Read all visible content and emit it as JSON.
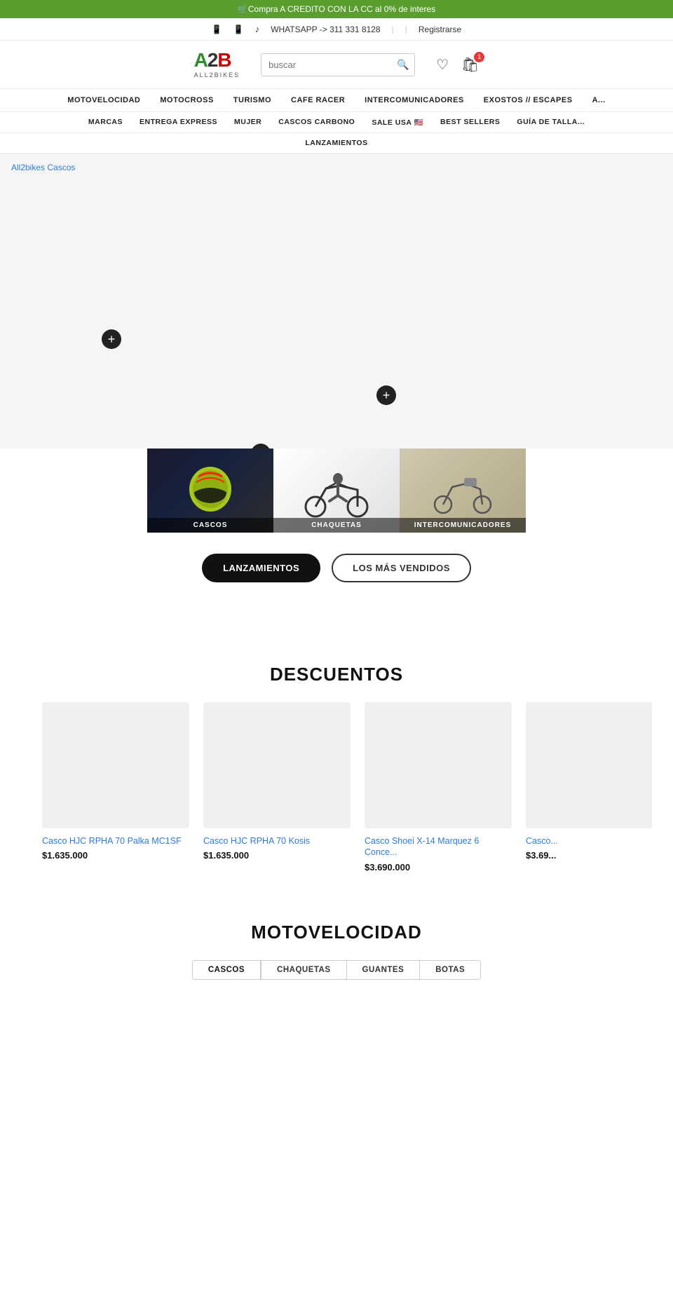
{
  "topBanner": {
    "text": "🛒Compra A CREDITO CON LA CC al 0% de interes"
  },
  "topBar": {
    "phoneIcon1": "📱",
    "phoneIcon2": "📱",
    "tiktokIcon": "♪",
    "whatsapp": "WHATSAPP -> 311 331 8128",
    "sep1": "|",
    "sep2": "|",
    "register": "Registrarse"
  },
  "header": {
    "logoText": "A2B",
    "logoSub": "ALL2BIKES",
    "searchPlaceholder": "buscar",
    "cartCount": "1"
  },
  "navPrimary": [
    "MOTOVELOCIDAD",
    "MOTOCROSS",
    "TURISMO",
    "CAFE RACER",
    "INTERCOMUNICADORES",
    "EXOSTOS // ESCAPES",
    "A..."
  ],
  "navSecondary": [
    "MARCAS",
    "ENTREGA EXPRESS",
    "MUJER",
    "CASCOS CARBONO",
    "SALE USA 🇺🇸",
    "BEST SELLERS",
    "GUÍA DE TALLA..."
  ],
  "navTertiary": [
    "LANZAMIENTOS"
  ],
  "breadcrumb": "All2bikes Cascos",
  "categories": [
    {
      "label": "CASCOS",
      "type": "helmet"
    },
    {
      "label": "CHAQUETAS",
      "type": "moto"
    },
    {
      "label": "INTERCOMUNICADORES",
      "type": "intercom"
    }
  ],
  "tabs": [
    {
      "label": "LANZAMIENTOS",
      "active": true
    },
    {
      "label": "LOS MÁS VENDIDOS",
      "active": false
    }
  ],
  "descuentos": {
    "title": "DESCUENTOS",
    "products": [
      {
        "name": "Casco HJC RPHA 70 Palka MC1SF",
        "price": "$1.635.000"
      },
      {
        "name": "Casco HJC RPHA 70 Kosis",
        "price": "$1.635.000"
      },
      {
        "name": "Casco Shoei X-14 Marquez 6 Conce...",
        "price": "$3.690.000"
      },
      {
        "name": "Casco...",
        "price": "$3.69..."
      }
    ]
  },
  "motovelocidad": {
    "title": "MOTOVELOCIDAD",
    "tabs": [
      "CASCOS",
      "CHAQUETAS",
      "GUANTES",
      "BOTAS"
    ],
    "activeTab": "CASCOS"
  }
}
